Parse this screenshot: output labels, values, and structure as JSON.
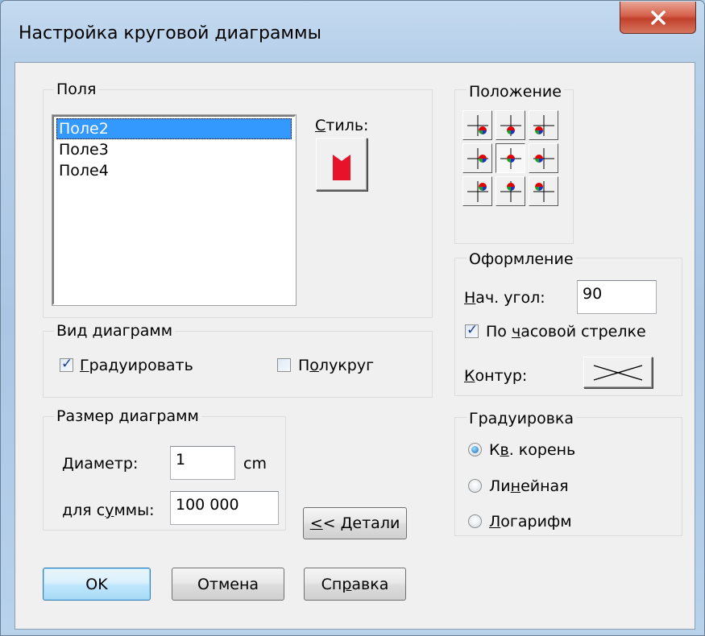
{
  "window": {
    "title": "Настройка круговой диаграммы",
    "close_glyph": "✕"
  },
  "fields_group": {
    "title": "Поля",
    "items": [
      {
        "label": "Поле2",
        "selected": true
      },
      {
        "label": "Поле3",
        "selected": false
      },
      {
        "label": "Поле4",
        "selected": false
      }
    ],
    "style_label": "Стиль:",
    "style_color": "#e8132b"
  },
  "position_group": {
    "title": "Положение",
    "selected": "center",
    "buttons": [
      "top-left",
      "top-center",
      "top-right",
      "middle-left",
      "center",
      "middle-right",
      "bottom-left",
      "bottom-center",
      "bottom-right"
    ]
  },
  "chart_view_group": {
    "title": "Вид диаграмм",
    "graduate": {
      "label": "Градуировать",
      "checked": true
    },
    "semicircle": {
      "label": "Полукруг",
      "checked": false
    }
  },
  "appearance_group": {
    "title": "Оформление",
    "start_angle_label": "Нач. угол:",
    "start_angle_value": "90",
    "clockwise": {
      "label": "По часовой стрелке",
      "checked": true
    },
    "outline_label": "Контур:"
  },
  "size_group": {
    "title": "Размер диаграмм",
    "diameter_label": "Диаметр:",
    "diameter_value": "1",
    "diameter_unit": "cm",
    "sum_label": "для суммы:",
    "sum_value": "100 000"
  },
  "graduation_group": {
    "title": "Градуировка",
    "options": [
      {
        "label": "Кв. корень",
        "checked": true
      },
      {
        "label": "Линейная",
        "checked": false
      },
      {
        "label": "Логарифм",
        "checked": false
      }
    ]
  },
  "buttons": {
    "details": "<< Детали",
    "ok": "OK",
    "cancel": "Отмена",
    "help": "Справка"
  },
  "colors": {
    "pie_red": "#e00000",
    "pie_green": "#1f9d2a",
    "pie_blue": "#2030c0",
    "selection": "#3399ff"
  },
  "icons": {
    "close": "close-icon",
    "style": "style-swatch-icon",
    "outline": "outline-line-icon"
  }
}
